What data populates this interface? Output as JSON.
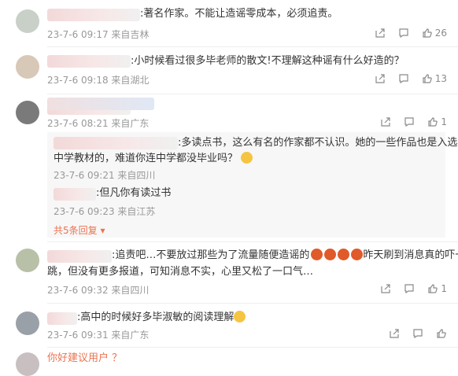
{
  "comments": [
    {
      "text": ":著名作家。不能让造谣零成本，必须追责。",
      "meta": "23-7-6 09:17 来自吉林",
      "likes": "26"
    },
    {
      "text": ":小时候看过很多毕老师的散文!不理解这种谣有什么好造的？",
      "meta": "23-7-6 09:18 来自湖北",
      "likes": "13"
    },
    {
      "text": "",
      "meta": "23-7-6 08:21 来自广东",
      "likes": "1",
      "replies": [
        {
          "text1": ":多读点书，这么有名的作家都不认识。她的一些作品也是入选了",
          "text2": "中学教材的，难道你连中学都没毕业吗？",
          "meta": "23-7-6 09:21 来自四川"
        },
        {
          "text1": ":但凡你有读过书",
          "meta": "23-7-6 09:23 来自江苏"
        }
      ],
      "more": "共5条回复"
    },
    {
      "text1": ":追责吧…不要放过那些为了流量随便造谣的",
      "text1b": "昨天刷到消息真的吓一",
      "text2": "跳，但没有更多报道，可知消息不实，心里又松了一口气…",
      "meta": "23-7-6 09:32 来自四川",
      "likes": "1"
    },
    {
      "text": ":高中的时候好多毕淑敏的阅读理解",
      "meta": "23-7-6 09:31 来自广东",
      "likes": ""
    }
  ],
  "bottom_partial": "你好建议用户 ？",
  "colors": {
    "link": "#eb7350",
    "meta": "#999999"
  },
  "icons": [
    "share-icon",
    "comment-icon",
    "like-icon"
  ]
}
